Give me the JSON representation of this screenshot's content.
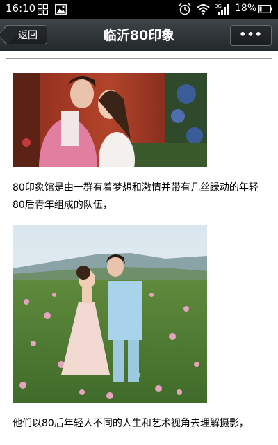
{
  "status_bar": {
    "time": "16:10",
    "battery": "18%",
    "icons": [
      "grid-icon",
      "image-icon",
      "alarm-icon",
      "wifi-icon",
      "signal-3g-icon",
      "battery-icon"
    ]
  },
  "nav": {
    "back_label": "返回",
    "title": "临沂80印象",
    "more_label": "•••"
  },
  "content": {
    "paragraph_1": "80印象馆是由一群有着梦想和激情并带有几丝躁动的年轻80后青年组成的队伍，",
    "paragraph_2": "他们以80后年轻人不同的人生和艺术视角去理解摄影，"
  },
  "colors": {
    "status_bar_bg": "#000000",
    "nav_bg": "#2e3437",
    "text": "#000000"
  }
}
